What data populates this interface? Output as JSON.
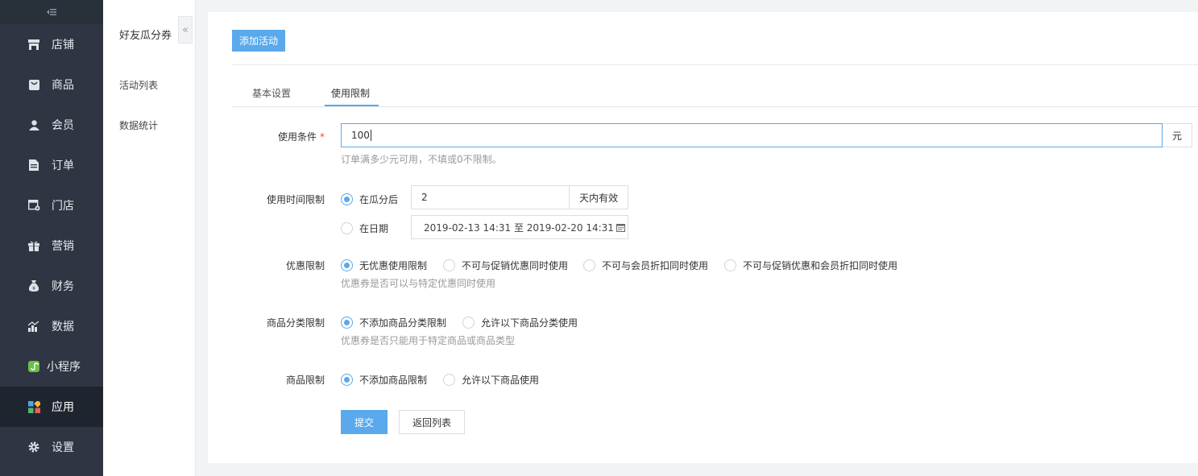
{
  "nav": {
    "items": [
      {
        "label": "店铺",
        "icon": "shop-icon"
      },
      {
        "label": "商品",
        "icon": "goods-icon"
      },
      {
        "label": "会员",
        "icon": "user-icon"
      },
      {
        "label": "订单",
        "icon": "order-icon"
      },
      {
        "label": "门店",
        "icon": "store-icon"
      },
      {
        "label": "营销",
        "icon": "gift-icon"
      },
      {
        "label": "财务",
        "icon": "money-bag-icon"
      },
      {
        "label": "数据",
        "icon": "chart-icon"
      },
      {
        "label": "小程序",
        "icon": "mini-program-icon"
      },
      {
        "label": "应用",
        "icon": "apps-icon"
      },
      {
        "label": "设置",
        "icon": "gear-icon"
      }
    ],
    "active": "应用"
  },
  "subnav": {
    "title": "好友瓜分券",
    "items": [
      "活动列表",
      "数据统计"
    ]
  },
  "toolbar": {
    "add_label": "添加活动"
  },
  "tabs": [
    "基本设置",
    "使用限制"
  ],
  "form": {
    "condition": {
      "label": "使用条件",
      "required": "*",
      "value": "100",
      "unit": "元",
      "hint": "订单满多少元可用，不填或0不限制。"
    },
    "time": {
      "label": "使用时间限制",
      "opt1": "在瓜分后",
      "days_value": "2",
      "days_unit": "天内有效",
      "opt2": "在日期",
      "date_range": "2019-02-13 14:31 至 2019-02-20 14:31"
    },
    "discount": {
      "label": "优惠限制",
      "options": [
        "无优惠使用限制",
        "不可与促销优惠同时使用",
        "不可与会员折扣同时使用",
        "不可与促销优惠和会员折扣同时使用"
      ],
      "hint": "优惠券是否可以与特定优惠同时使用"
    },
    "category": {
      "label": "商品分类限制",
      "options": [
        "不添加商品分类限制",
        "允许以下商品分类使用"
      ],
      "hint": "优惠券是否只能用于特定商品或商品类型"
    },
    "goods": {
      "label": "商品限制",
      "options": [
        "不添加商品限制",
        "允许以下商品使用"
      ]
    }
  },
  "actions": {
    "submit": "提交",
    "back": "返回列表"
  },
  "colors": {
    "accent": "#5aa9ec",
    "sidebar": "#2f3542",
    "required": "#e54d42"
  }
}
